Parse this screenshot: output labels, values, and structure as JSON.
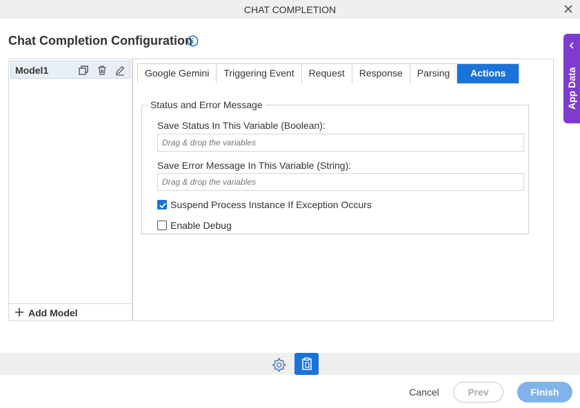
{
  "window": {
    "title": "CHAT COMPLETION",
    "close_icon": "close-icon"
  },
  "page": {
    "heading": "Chat Completion Configuration",
    "info_icon": "info-icon"
  },
  "app_data_tab": {
    "label": "App Data",
    "icon": "chevron-left-icon",
    "color": "#7e3ccf"
  },
  "models": {
    "items": [
      {
        "name": "Model1"
      }
    ],
    "item_icons": [
      "copy-icon",
      "delete-icon",
      "edit-icon"
    ],
    "add_label": "Add Model"
  },
  "tabs": [
    {
      "label": "Google Gemini",
      "active": false
    },
    {
      "label": "Triggering Event",
      "active": false
    },
    {
      "label": "Request",
      "active": false
    },
    {
      "label": "Response",
      "active": false
    },
    {
      "label": "Parsing",
      "active": false
    },
    {
      "label": "Actions",
      "active": true
    }
  ],
  "status_section": {
    "legend": "Status and Error Message",
    "status_label": "Save Status In This Variable (Boolean):",
    "status_placeholder": "Drag & drop the variables",
    "status_value": "",
    "error_label": "Save Error Message In This Variable (String):",
    "error_placeholder": "Drag & drop the variables",
    "error_value": "",
    "suspend_label": "Suspend Process Instance If Exception Occurs",
    "suspend_checked": true,
    "debug_label": "Enable Debug",
    "debug_checked": false
  },
  "footer": {
    "cancel": "Cancel",
    "prev": "Prev",
    "finish": "Finish",
    "toolbar_icons": [
      "gear-icon",
      "document-icon"
    ]
  },
  "colors": {
    "accent": "#1a73d9",
    "finish_disabled": "#7fb3ea",
    "app_data": "#7e3ccf"
  }
}
